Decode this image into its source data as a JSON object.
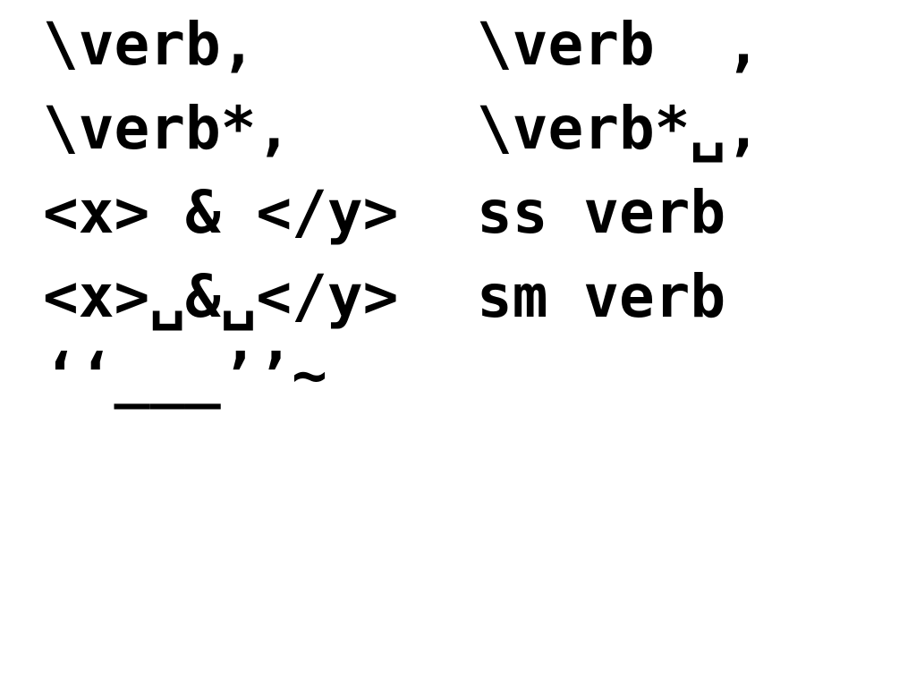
{
  "left_column": {
    "line1": "\\verb,",
    "line2": "\\verb*,",
    "line3": "<x> & </y>",
    "line4": "<x>␣&␣</y>",
    "line5": "‘‘___’’~"
  },
  "right_column": {
    "line1": "\\verb  ,",
    "line2": "\\verb*␣,",
    "line3": "ss verb",
    "line4": "sm verb"
  }
}
